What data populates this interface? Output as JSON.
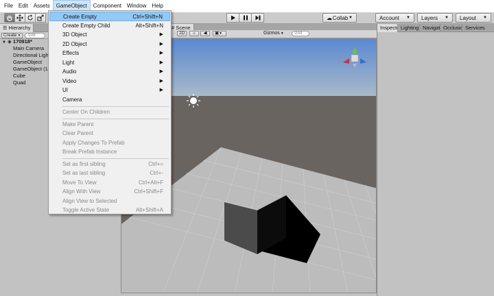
{
  "menubar": {
    "items": [
      "File",
      "Edit",
      "Assets",
      "GameObject",
      "Component",
      "Window",
      "Help"
    ]
  },
  "toolbar": {
    "collab": "Collab",
    "account": "Account",
    "layers": "Layers",
    "layout": "Layout"
  },
  "hierarchy": {
    "tab": "Hierarchy",
    "create": "Create",
    "search_placeholder": "All",
    "scene_name": "170918*",
    "items": [
      "Main Camera",
      "Directional Light",
      "GameObject",
      "GameObject (1)",
      "Cube",
      "Quad"
    ]
  },
  "scene": {
    "tab": "Scene",
    "mode_2d": "2D",
    "gizmos": "Gizmos",
    "search_placeholder": "All"
  },
  "right_tabs": [
    "Inspector",
    "Lighting",
    "Navigation",
    "Occlusion",
    "Services"
  ],
  "gameobject_menu": {
    "items": [
      {
        "label": "Create Empty",
        "shortcut": "Ctrl+Shift+N",
        "highlighted": true
      },
      {
        "label": "Create Empty Child",
        "shortcut": "Alt+Shift+N"
      },
      {
        "label": "3D Object",
        "submenu": true
      },
      {
        "label": "2D Object",
        "submenu": true
      },
      {
        "label": "Effects",
        "submenu": true
      },
      {
        "label": "Light",
        "submenu": true
      },
      {
        "label": "Audio",
        "submenu": true
      },
      {
        "label": "Video",
        "submenu": true
      },
      {
        "label": "UI",
        "submenu": true
      },
      {
        "label": "Camera"
      },
      {
        "label": "Center On Children",
        "disabled": true
      },
      {
        "label": "Make Parent",
        "disabled": true
      },
      {
        "label": "Clear Parent",
        "disabled": true
      },
      {
        "label": "Apply Changes To Prefab",
        "disabled": true
      },
      {
        "label": "Break Prefab Instance",
        "disabled": true
      },
      {
        "label": "Set as first sibling",
        "shortcut": "Ctrl+=",
        "disabled": true
      },
      {
        "label": "Set as last sibling",
        "shortcut": "Ctrl+-",
        "disabled": true
      },
      {
        "label": "Move To View",
        "shortcut": "Ctrl+Alt+F",
        "disabled": true
      },
      {
        "label": "Align With View",
        "shortcut": "Ctrl+Shift+F",
        "disabled": true
      },
      {
        "label": "Align View to Selected",
        "disabled": true
      },
      {
        "label": "Toggle Active State",
        "shortcut": "Alt+Shift+A",
        "disabled": true
      }
    ]
  },
  "colors": {
    "sky_top": "#5a89d1",
    "sky_horizon": "#a9b9c9",
    "ground": "#6a6461",
    "plane": "#bcbcbc",
    "menu_highlight": "#91c9f7"
  }
}
